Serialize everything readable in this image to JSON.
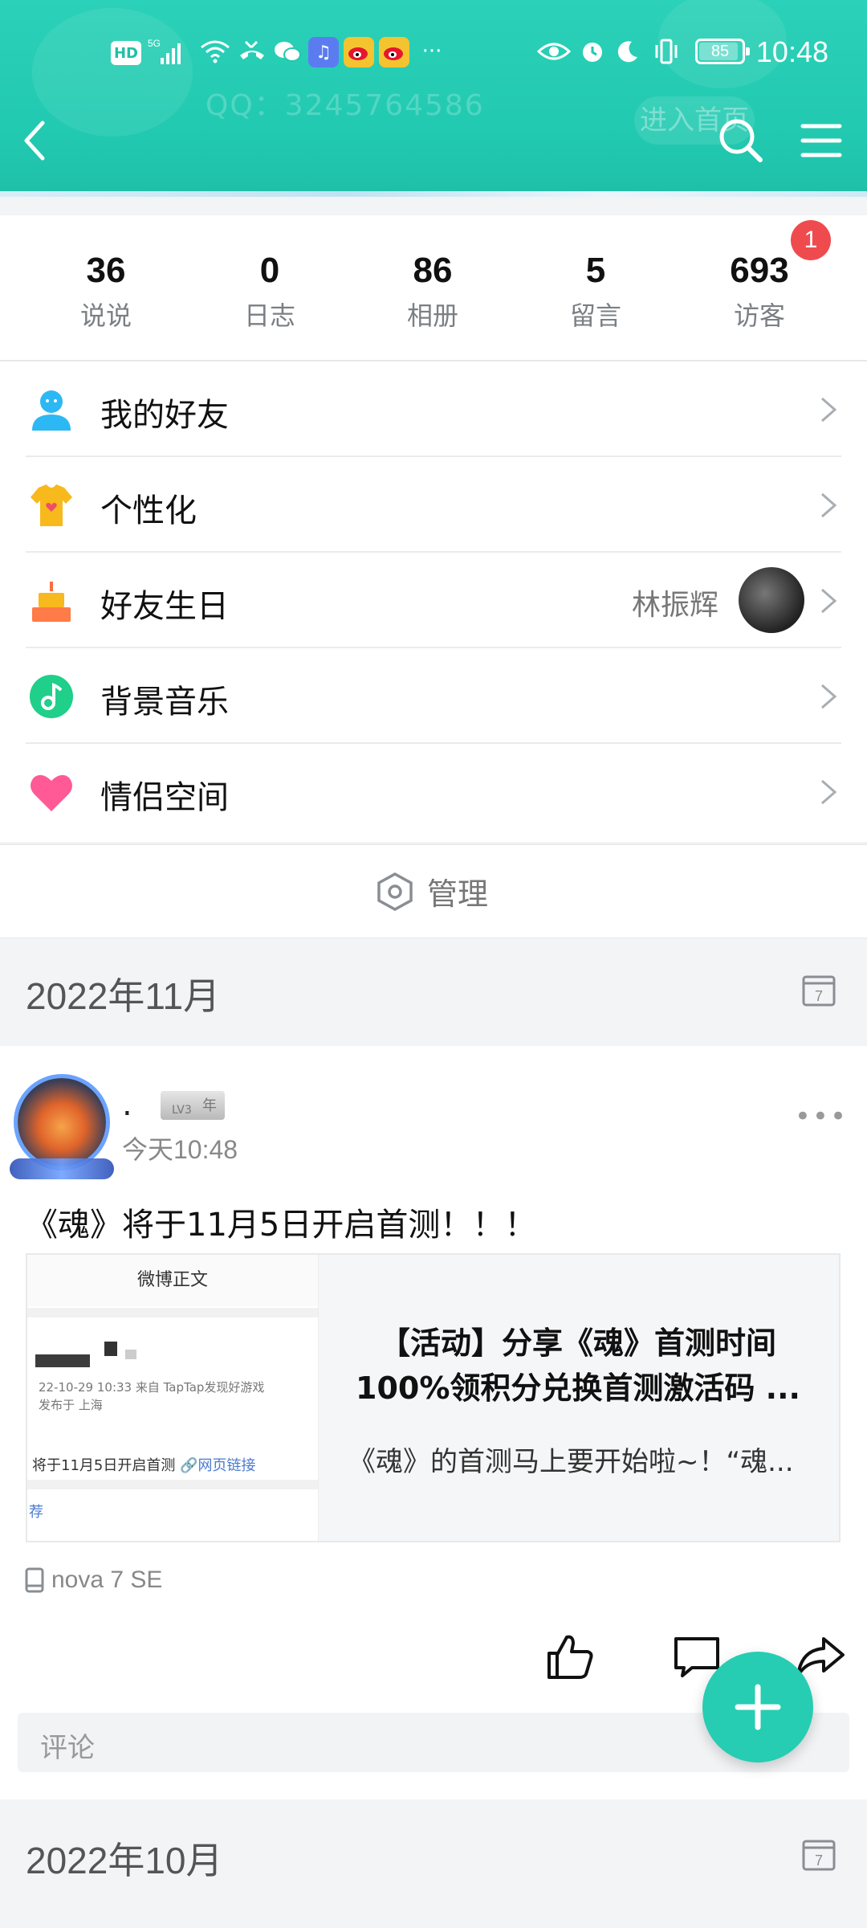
{
  "status_bar": {
    "time": "10:48",
    "battery": "85",
    "hd": "HD",
    "more": "···"
  },
  "header": {
    "watermark_qq": "QQ：3245764586",
    "watermark_enter": "进入首页"
  },
  "stats": [
    {
      "value": "36",
      "label": "说说"
    },
    {
      "value": "0",
      "label": "日志"
    },
    {
      "value": "86",
      "label": "相册"
    },
    {
      "value": "5",
      "label": "留言"
    },
    {
      "value": "693",
      "label": "访客"
    }
  ],
  "visitor_badge": "1",
  "menu": [
    {
      "label": "我的好友",
      "icon": "friend-icon"
    },
    {
      "label": "个性化",
      "icon": "personalize-icon"
    },
    {
      "label": "好友生日",
      "icon": "birthday-cake-icon",
      "extra": "林振辉"
    },
    {
      "label": "背景音乐",
      "icon": "music-icon"
    },
    {
      "label": "情侣空间",
      "icon": "heart-icon"
    }
  ],
  "manage_label": "管理",
  "sections": {
    "first_date": "2022年11月",
    "second_date": "2022年10月"
  },
  "post": {
    "author": ".",
    "level": "LV3",
    "level_year": "年",
    "time": "今天10:48",
    "content": "《魂》将于11月5日开启首测！！！",
    "card": {
      "thumb_header": "微博正文",
      "thumb_meta1": "22-10-29 10:33  来自 TapTap发现好游戏",
      "thumb_meta2": "发布于 上海",
      "thumb_line": "将于11月5日开启首测",
      "thumb_link": "🔗网页链接",
      "thumb_rec": "荐",
      "title": "【活动】分享《魂》首测时间100%领积分兑换首测激活码 ...",
      "desc": "《魂》的首测马上要开始啦~！“魂..."
    },
    "device": "nova 7 SE",
    "comment_placeholder": "评论"
  },
  "colors": {
    "header": "#21c9b0",
    "accent": "#26cdb2",
    "badge": "#ef4b4f"
  }
}
